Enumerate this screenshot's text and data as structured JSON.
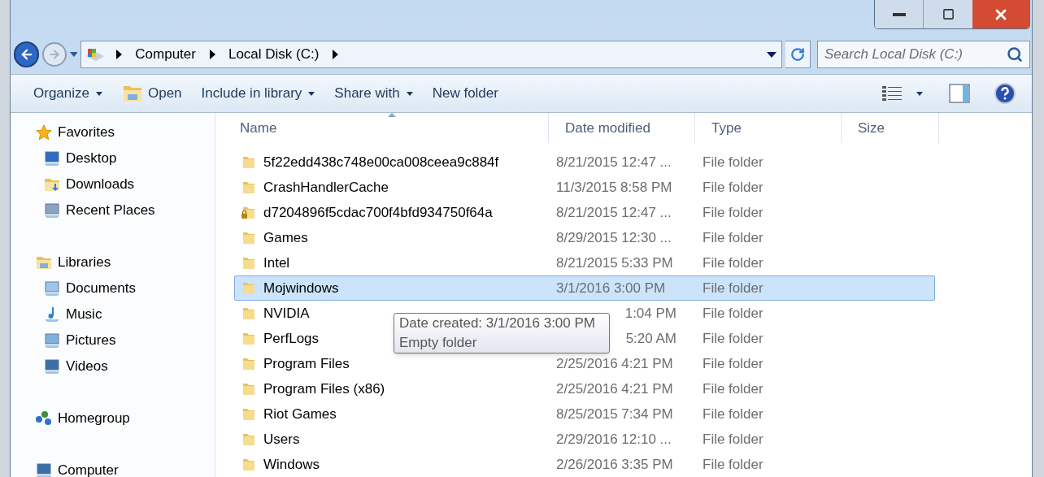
{
  "address_bar": {
    "crumbs": [
      "Computer",
      "Local Disk (C:)"
    ]
  },
  "search": {
    "placeholder": "Search Local Disk (C:)"
  },
  "toolbar": {
    "buttons": [
      {
        "label": "Organize",
        "kind": "menu"
      },
      {
        "label": "Open",
        "kind": "icon"
      },
      {
        "label": "Include in library",
        "kind": "menu"
      },
      {
        "label": "Share with",
        "kind": "menu"
      },
      {
        "label": "New folder",
        "kind": "plain"
      }
    ]
  },
  "navigation": [
    {
      "label": "Favorites",
      "kind": "star",
      "children": [
        {
          "label": "Desktop",
          "kind": "desktop"
        },
        {
          "label": "Downloads",
          "kind": "downloads"
        },
        {
          "label": "Recent Places",
          "kind": "recent"
        }
      ]
    },
    {
      "label": "Libraries",
      "kind": "library",
      "children": [
        {
          "label": "Documents",
          "kind": "documents"
        },
        {
          "label": "Music",
          "kind": "music"
        },
        {
          "label": "Pictures",
          "kind": "pictures"
        },
        {
          "label": "Videos",
          "kind": "videos"
        }
      ]
    },
    {
      "label": "Homegroup",
      "kind": "homegroup"
    },
    {
      "label": "Computer",
      "kind": "computer"
    }
  ],
  "table": {
    "columns": [
      "Name",
      "Date modified",
      "Type",
      "Size"
    ],
    "rows": [
      {
        "name": "5f22edd438c748e00ca008ceea9c884f",
        "date": "8/21/2015 12:47 ...",
        "type": "File folder",
        "selected": false,
        "locked": false,
        "clipped": false
      },
      {
        "name": "CrashHandlerCache",
        "date": "11/3/2015 8:58 PM",
        "type": "File folder",
        "selected": false,
        "locked": false,
        "clipped": false
      },
      {
        "name": "d7204896f5cdac700f4bfd934750f64a",
        "date": "8/21/2015 12:47 ...",
        "type": "File folder",
        "selected": false,
        "locked": true,
        "clipped": false
      },
      {
        "name": "Games",
        "date": "8/29/2015 12:30 ...",
        "type": "File folder",
        "selected": false,
        "locked": false,
        "clipped": false
      },
      {
        "name": "Intel",
        "date": "8/21/2015 5:33 PM",
        "type": "File folder",
        "selected": false,
        "locked": false,
        "clipped": false
      },
      {
        "name": "Mojwindows",
        "date": "3/1/2016 3:00 PM",
        "type": "File folder",
        "selected": true,
        "locked": false,
        "clipped": false
      },
      {
        "name": "NVIDIA",
        "date": "1:04 PM",
        "type": "File folder",
        "selected": false,
        "locked": false,
        "clipped": true
      },
      {
        "name": "PerfLogs",
        "date": "5:20 AM",
        "type": "File folder",
        "selected": false,
        "locked": false,
        "clipped": true
      },
      {
        "name": "Program Files",
        "date": "2/25/2016 4:21 PM",
        "type": "File folder",
        "selected": false,
        "locked": false,
        "clipped": false
      },
      {
        "name": "Program Files (x86)",
        "date": "2/25/2016 4:21 PM",
        "type": "File folder",
        "selected": false,
        "locked": false,
        "clipped": false
      },
      {
        "name": "Riot Games",
        "date": "8/25/2015 7:34 PM",
        "type": "File folder",
        "selected": false,
        "locked": false,
        "clipped": false
      },
      {
        "name": "Users",
        "date": "2/29/2016 12:10 ...",
        "type": "File folder",
        "selected": false,
        "locked": false,
        "clipped": false
      },
      {
        "name": "Windows",
        "date": "2/26/2016 3:35 PM",
        "type": "File folder",
        "selected": false,
        "locked": false,
        "clipped": false
      }
    ]
  },
  "tooltip": {
    "lines": [
      "Date created: 3/1/2016 3:00 PM",
      "Empty folder"
    ]
  }
}
